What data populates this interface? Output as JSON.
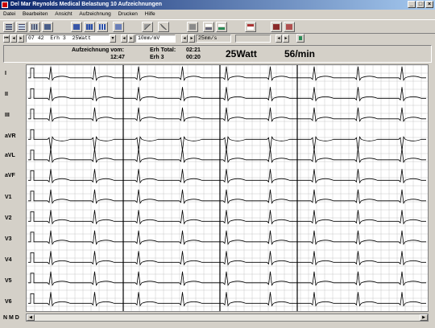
{
  "window": {
    "title": "Del Mar Reynolds Medical Belastung 10 Aufzeichnungen",
    "minimize": "_",
    "maximize": "□",
    "close": "×"
  },
  "menu": [
    {
      "label": "Datei"
    },
    {
      "label": "Bearbeiten"
    },
    {
      "label": "Ansicht"
    },
    {
      "label": "Aufzeichnung"
    },
    {
      "label": "Drucken"
    },
    {
      "label": "Hilfe"
    }
  ],
  "controls": {
    "time": "07 42",
    "stage": "Erh 3",
    "load": "25Watt",
    "gain": "10mm/mV",
    "speed": "25mm/s"
  },
  "info": {
    "record_label": "Aufzeichnung vom:",
    "record_time": "12:47",
    "erh_total_label": "Erh Total:",
    "erh_total_value": "02:21",
    "erh_label": "Erh 3",
    "erh_value": "00:20",
    "watt": "25Watt",
    "rate": "56/min"
  },
  "leads": [
    "I",
    "II",
    "III",
    "aVR",
    "aVL",
    "aVF",
    "V1",
    "V2",
    "V3",
    "V4",
    "V5",
    "V6"
  ],
  "footer": {
    "label": "N M D"
  },
  "colors": {
    "title_start": "#0a246a",
    "title_end": "#a6caf0",
    "grid": "#c8c8c8",
    "trace": "#000000"
  }
}
